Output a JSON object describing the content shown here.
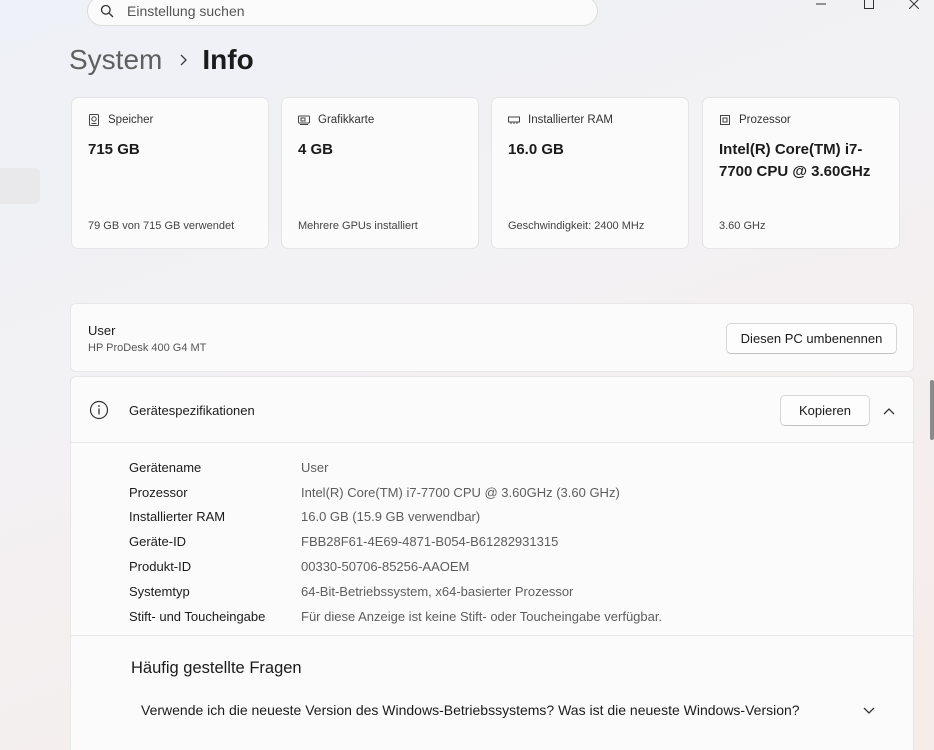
{
  "search": {
    "placeholder": "Einstellung suchen"
  },
  "window_controls": {
    "icons": [
      "minimize-icon",
      "maximize-icon",
      "close-icon"
    ]
  },
  "breadcrumb": {
    "parent": "System",
    "current": "Info"
  },
  "cards": [
    {
      "icon": "storage-icon",
      "label": "Speicher",
      "value": "715 GB",
      "footer": "79 GB von 715 GB verwendet"
    },
    {
      "icon": "graphics-card-icon",
      "label": "Grafikkarte",
      "value": "4 GB",
      "footer": "Mehrere GPUs installiert"
    },
    {
      "icon": "ram-icon",
      "label": "Installierter RAM",
      "value": "16.0 GB",
      "footer": "Geschwindigkeit: 2400 MHz"
    },
    {
      "icon": "processor-icon",
      "label": "Prozessor",
      "value": "Intel(R) Core(TM) i7-7700 CPU @ 3.60GHz",
      "footer": "3.60 GHz"
    }
  ],
  "pc": {
    "name": "User",
    "model": "HP ProDesk 400 G4 MT",
    "rename_label": "Diesen PC umbenennen"
  },
  "specs": {
    "title": "Gerätespezifikationen",
    "copy_label": "Kopieren",
    "rows": [
      {
        "label": "Gerätename",
        "value": "User"
      },
      {
        "label": "Prozessor",
        "value": "Intel(R) Core(TM) i7-7700 CPU @ 3.60GHz (3.60 GHz)"
      },
      {
        "label": "Installierter RAM",
        "value": "16.0 GB (15.9 GB verwendbar)"
      },
      {
        "label": "Geräte-ID",
        "value": "FBB28F61-4E69-4871-B054-B61282931315"
      },
      {
        "label": "Produkt-ID",
        "value": "00330-50706-85256-AAOEM"
      },
      {
        "label": "Systemtyp",
        "value": "64-Bit-Betriebssystem, x64-basierter Prozessor"
      },
      {
        "label": "Stift- und Toucheingabe",
        "value": "Für diese Anzeige ist keine Stift- oder Toucheingabe verfügbar."
      }
    ]
  },
  "faq": {
    "title": "Häufig gestellte Fragen",
    "question": "Verwende ich die neueste Version des Windows-Betriebssystems? Was ist die neueste Windows-Version?"
  }
}
